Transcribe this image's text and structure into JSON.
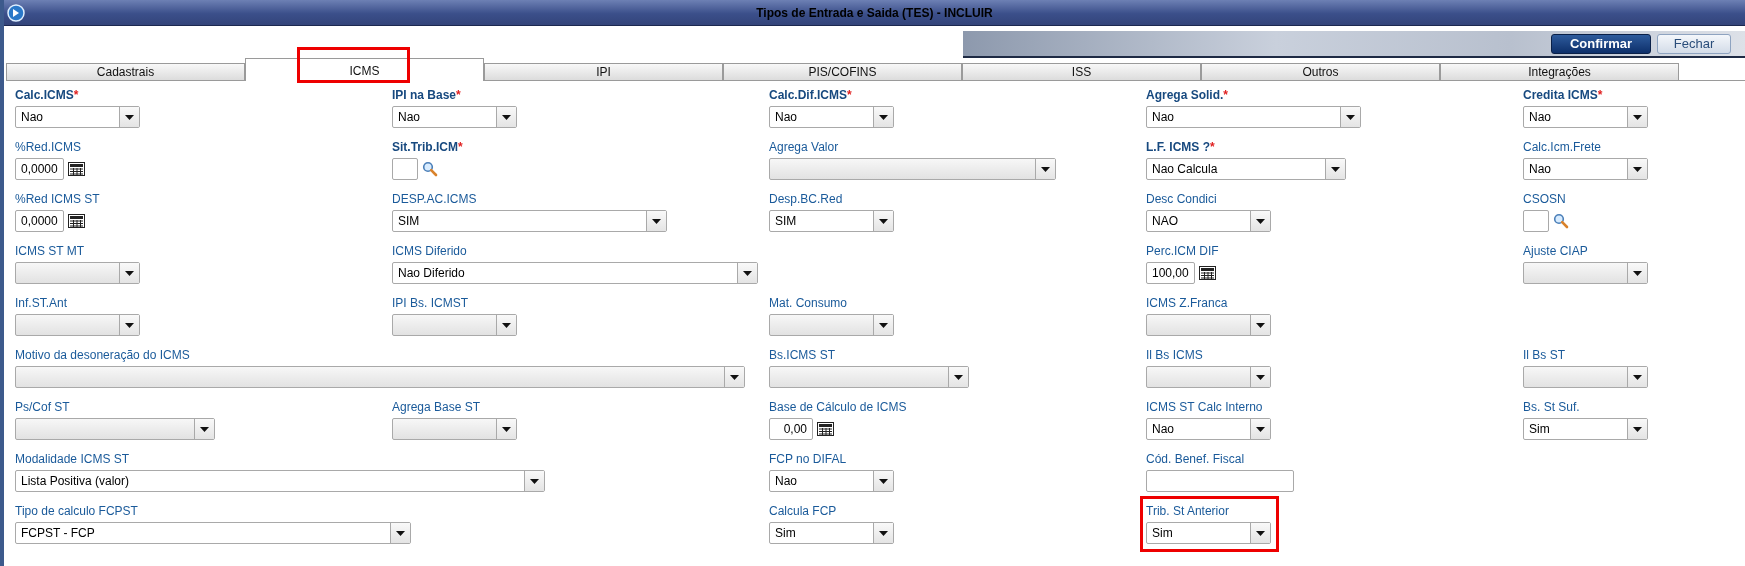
{
  "window": {
    "title": "Tipos de Entrada e Saida (TES) - INCLUIR"
  },
  "toolbar": {
    "buttons": [
      {
        "label": "Confirmar",
        "kind": "primary"
      },
      {
        "label": "Fechar",
        "kind": "secondary"
      }
    ]
  },
  "tabs": [
    {
      "label": "Cadastrais",
      "selected": false,
      "highlighted": false
    },
    {
      "label": "ICMS",
      "selected": true,
      "highlighted": true
    },
    {
      "label": "IPI",
      "selected": false,
      "highlighted": false
    },
    {
      "label": "PIS/COFINS",
      "selected": false,
      "highlighted": false
    },
    {
      "label": "ISS",
      "selected": false,
      "highlighted": false
    },
    {
      "label": "Outros",
      "selected": false,
      "highlighted": false
    },
    {
      "label": "Integrações",
      "selected": false,
      "highlighted": false
    }
  ],
  "rows": [
    {
      "fields": [
        {
          "kind": "select",
          "label": "Calc.ICMS",
          "required_mark": "*",
          "value": "Nao",
          "highlighted": false
        },
        {
          "kind": "select",
          "label": "IPI na Base",
          "required_mark": "*",
          "value": "Nao",
          "highlighted": false
        },
        {
          "kind": "select",
          "label": "Calc.Dif.ICMS",
          "required_mark": "*",
          "value": "Nao",
          "highlighted": false
        },
        {
          "kind": "select",
          "label": "Agrega Solid.",
          "required_mark": "*",
          "value": "Nao",
          "highlighted": false
        },
        {
          "kind": "select",
          "label": "Credita ICMS",
          "required_mark": "*",
          "value": "Nao",
          "highlighted": false
        }
      ]
    },
    {
      "fields": [
        {
          "kind": "number",
          "label": "%Red.ICMS",
          "value": "0,0000",
          "highlighted": false
        },
        {
          "kind": "lookup",
          "label": "Sit.Trib.ICM",
          "required_mark": "*",
          "highlighted": false
        },
        {
          "kind": "select",
          "label": "Agrega Valor",
          "highlighted": false
        },
        {
          "kind": "select",
          "label": "L.F. ICMS ?",
          "required_mark": "*",
          "value": "Nao Calcula",
          "highlighted": false
        },
        {
          "kind": "select",
          "label": "Calc.Icm.Frete",
          "value": "Nao",
          "highlighted": false
        }
      ]
    },
    {
      "fields": [
        {
          "kind": "number",
          "label": "%Red ICMS ST",
          "value": "0,0000",
          "highlighted": false
        },
        {
          "kind": "select",
          "label": "DESP.AC.ICMS",
          "value": "SIM",
          "highlighted": false
        },
        {
          "kind": "select",
          "label": "Desp.BC.Red",
          "value": "SIM",
          "highlighted": false
        },
        {
          "kind": "select",
          "label": "Desc Condici",
          "value": "NAO",
          "highlighted": false
        },
        {
          "kind": "lookup",
          "label": "CSOSN",
          "highlighted": false
        }
      ]
    },
    {
      "fields": [
        {
          "kind": "select",
          "label": "ICMS ST MT",
          "highlighted": false
        },
        {
          "kind": "select",
          "label": "ICMS Diferido",
          "value": "Nao Diferido",
          "highlighted": false
        },
        {
          "kind": "number",
          "label": "Perc.ICM DIF",
          "value": "100,00",
          "highlighted": false
        },
        {
          "kind": "select",
          "label": "Ajuste CIAP",
          "highlighted": false
        }
      ]
    },
    {
      "fields": [
        {
          "kind": "select",
          "label": "Inf.ST.Ant",
          "highlighted": false
        },
        {
          "kind": "select",
          "label": "IPI Bs. ICMST",
          "highlighted": false
        },
        {
          "kind": "select",
          "label": "Mat. Consumo",
          "highlighted": false
        },
        {
          "kind": "select",
          "label": "ICMS Z.Franca",
          "highlighted": false
        }
      ]
    },
    {
      "fields": [
        {
          "kind": "select",
          "label": "Motivo da desoneração do ICMS",
          "highlighted": false
        },
        {
          "kind": "select",
          "label": "Bs.ICMS ST",
          "highlighted": false
        },
        {
          "kind": "select",
          "label": "Il Bs ICMS",
          "highlighted": false
        },
        {
          "kind": "select",
          "label": "Il Bs ST",
          "highlighted": false
        }
      ]
    },
    {
      "fields": [
        {
          "kind": "select",
          "label": "Ps/Cof ST",
          "highlighted": false
        },
        {
          "kind": "select",
          "label": "Agrega Base ST",
          "highlighted": false
        },
        {
          "kind": "number",
          "label": "Base de Cálculo de ICMS",
          "value": "0,00",
          "highlighted": false
        },
        {
          "kind": "select",
          "label": "ICMS ST Calc Interno",
          "value": "Nao",
          "highlighted": false
        },
        {
          "kind": "select",
          "label": "Bs. St Suf.",
          "value": "Sim",
          "highlighted": false
        }
      ]
    },
    {
      "fields": [
        {
          "kind": "select",
          "label": "Modalidade ICMS ST",
          "value": "Lista Positiva (valor)",
          "highlighted": false
        },
        {
          "kind": "select",
          "label": "FCP no DIFAL",
          "value": "Nao",
          "highlighted": false
        },
        {
          "kind": "text",
          "label": "Cód. Benef. Fiscal",
          "highlighted": false
        }
      ]
    },
    {
      "fields": [
        {
          "kind": "select",
          "label": "Tipo de calculo FCPST",
          "value": "FCPST -  FCP",
          "highlighted": false
        },
        {
          "kind": "select",
          "label": "Calcula FCP",
          "value": "Sim",
          "highlighted": false
        },
        {
          "kind": "select",
          "label": "Trib. St Anterior",
          "value": "Sim",
          "highlighted": true
        }
      ]
    }
  ]
}
